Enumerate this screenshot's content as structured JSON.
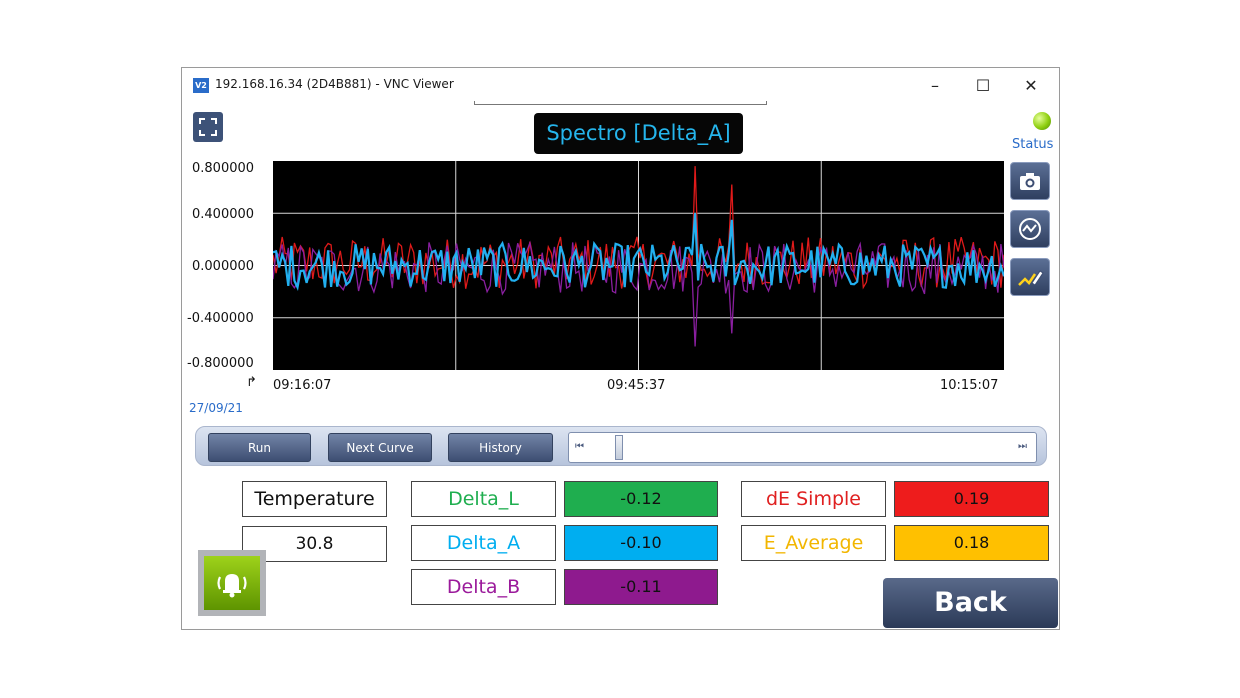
{
  "window": {
    "title": "192.168.16.34 (2D4B881) - VNC Viewer",
    "app_icon": "V2",
    "minimize": "–",
    "maximize": "☐",
    "close": "✕"
  },
  "header": {
    "title": "Spectro [Delta_A]",
    "status_label": "Status",
    "status_color": "#8fcf10"
  },
  "icons": {
    "fullscreen": "fullscreen-icon",
    "camera": "camera-icon",
    "trend": "trend-icon",
    "curve_edit": "curve-edit-icon",
    "alarm": "alarm-bell-icon",
    "arrow": "↱"
  },
  "controls": {
    "run": "Run",
    "next_curve": "Next Curve",
    "history": "History",
    "skip_start": "⏮",
    "skip_end": "⏭",
    "slider_position": 0.05
  },
  "measurements": {
    "temperature_label": "Temperature",
    "temperature_value": "30.8",
    "delta_l_label": "Delta_L",
    "delta_l_value": "-0.12",
    "delta_a_label": "Delta_A",
    "delta_a_value": "-0.10",
    "delta_b_label": "Delta_B",
    "delta_b_value": "-0.11",
    "de_simple_label": "dE Simple",
    "de_simple_value": "0.19",
    "e_average_label": "E_Average",
    "e_average_value": "0.18",
    "colors": {
      "delta_l": "#1fae4f",
      "delta_a": "#00aef0",
      "delta_b": "#9b1a9b",
      "de_simple": "#e02020",
      "e_average": "#f2b600",
      "delta_l_box": "#1fae4f",
      "delta_a_box": "#00aef0",
      "delta_b_box": "#8e1a8e",
      "de_simple_box": "#ee1c1c",
      "e_average_box": "#ffc000"
    }
  },
  "back_label": "Back",
  "chart_data": {
    "type": "line",
    "title": "Spectro [Delta_A]",
    "x_ticks": [
      "09:16:07",
      "09:45:37",
      "10:15:07"
    ],
    "date": "27/09/21",
    "y_ticks": [
      "0.800000",
      "0.400000",
      "0.000000",
      "-0.400000",
      "-0.800000"
    ],
    "ylim": [
      -0.8,
      0.8
    ],
    "grid": true,
    "series_colors": [
      "#e01a1a",
      "#8a1fa0",
      "#22b0f0"
    ],
    "samples": 240,
    "spikes": [
      {
        "series": 0,
        "index": 138,
        "value": 0.76
      },
      {
        "series": 0,
        "index": 150,
        "value": 0.62
      },
      {
        "series": 1,
        "index": 138,
        "value": -0.62
      },
      {
        "series": 1,
        "index": 150,
        "value": -0.52
      },
      {
        "series": 2,
        "index": 138,
        "value": 0.4
      },
      {
        "series": 2,
        "index": 150,
        "value": 0.35
      }
    ]
  }
}
